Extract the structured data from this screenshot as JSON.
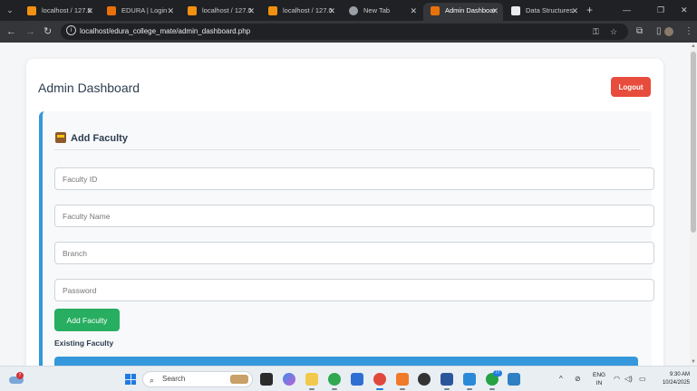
{
  "browser": {
    "tabs": [
      {
        "label": "localhost / 127.0",
        "favicon": "phpmyadmin-icon",
        "favicon_color": "#f29111",
        "active": false
      },
      {
        "label": "EDURA | Login",
        "favicon": "edura-icon",
        "favicon_color": "#e8710a",
        "active": false
      },
      {
        "label": "localhost / 127.0",
        "favicon": "phpmyadmin-icon",
        "favicon_color": "#f29111",
        "active": false
      },
      {
        "label": "localhost / 127.0",
        "favicon": "phpmyadmin-icon",
        "favicon_color": "#f29111",
        "active": false
      },
      {
        "label": "New Tab",
        "favicon": "chrome-icon",
        "favicon_color": "#9aa0a6",
        "active": false
      },
      {
        "label": "Admin Dashboard",
        "favicon": "edura-icon",
        "favicon_color": "#e8710a",
        "active": true
      },
      {
        "label": "Data Structures",
        "favicon": "book-icon",
        "favicon_color": "#e8eaed",
        "active": false
      }
    ],
    "url": "localhost/edura_college_mate/admin_dashboard.php"
  },
  "page": {
    "title": "Admin Dashboard",
    "logout_label": "Logout",
    "add_faculty": {
      "heading": "Add Faculty",
      "heading_icon": "books-emoji-icon",
      "fields": {
        "faculty_id": {
          "placeholder": "Faculty ID",
          "value": ""
        },
        "faculty_name": {
          "placeholder": "Faculty Name",
          "value": ""
        },
        "branch": {
          "placeholder": "Branch",
          "value": ""
        },
        "password": {
          "placeholder": "Password",
          "value": ""
        }
      },
      "submit_label": "Add Faculty",
      "existing_label": "Existing Faculty"
    }
  },
  "colors": {
    "accent_blue": "#3498db",
    "logout_red": "#e74c3c",
    "submit_green": "#27ae60",
    "heading_text": "#2c3e50"
  },
  "taskbar": {
    "search_label": "Search",
    "weather_badge": "7",
    "notification_badge": "77",
    "language": "ENG",
    "region": "IN",
    "time": "9:30 AM",
    "date": "10/24/2025"
  }
}
